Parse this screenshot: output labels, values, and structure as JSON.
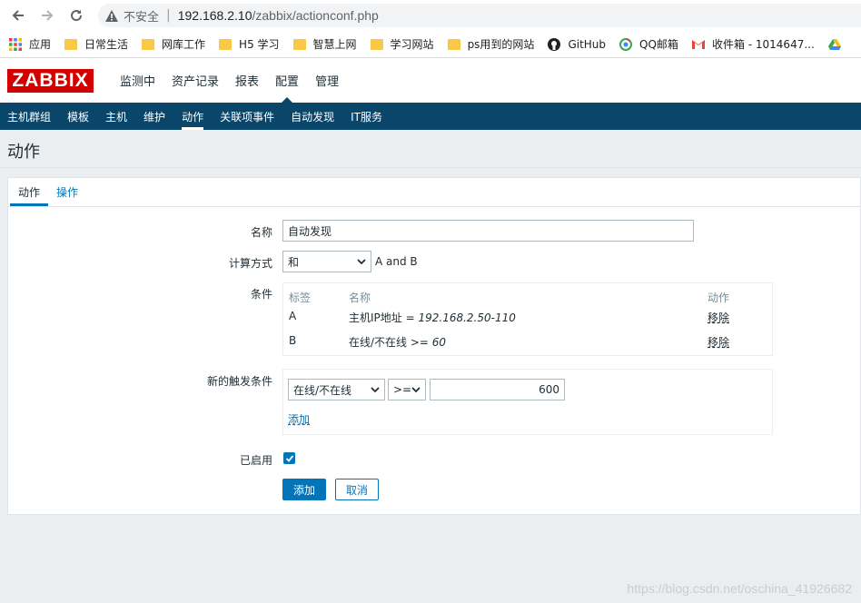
{
  "browser": {
    "insecure_label": "不安全",
    "url_host": "192.168.2.10",
    "url_path": "/zabbix/actionconf.php",
    "bookmarks": [
      "应用",
      "日常生活",
      "网库工作",
      "H5 学习",
      "智慧上网",
      "学习网站",
      "ps用到的网站",
      "GitHub",
      "QQ邮箱",
      "收件箱 - 1014647..."
    ]
  },
  "header": {
    "logo": "ZABBIX",
    "menu": [
      "监测中",
      "资产记录",
      "报表",
      "配置",
      "管理"
    ],
    "submenu": [
      "主机群组",
      "模板",
      "主机",
      "维护",
      "动作",
      "关联项事件",
      "自动发现",
      "IT服务"
    ]
  },
  "page": {
    "title": "动作",
    "tabs": [
      "动作",
      "操作"
    ]
  },
  "form": {
    "name_label": "名称",
    "name_value": "自动发现",
    "calc_label": "计算方式",
    "calc_value": "和",
    "calc_text": "A and B",
    "conditions_label": "条件",
    "cond_headers": [
      "标签",
      "名称",
      "动作"
    ],
    "conditions": [
      {
        "label": "A",
        "prefix": "主机IP地址 = ",
        "value": "192.168.2.50-110",
        "action": "移除"
      },
      {
        "label": "B",
        "prefix": "在线/不在线 >= ",
        "value": "60",
        "action": "移除"
      }
    ],
    "new_cond_label": "新的触发条件",
    "new_cond_type": "在线/不在线",
    "new_cond_op": ">=",
    "new_cond_value": "600",
    "add_link": "添加",
    "enabled_label": "已启用",
    "enabled": true,
    "add_button": "添加",
    "cancel_button": "取消"
  },
  "watermark": "https://blog.csdn.net/oschina_41926682"
}
